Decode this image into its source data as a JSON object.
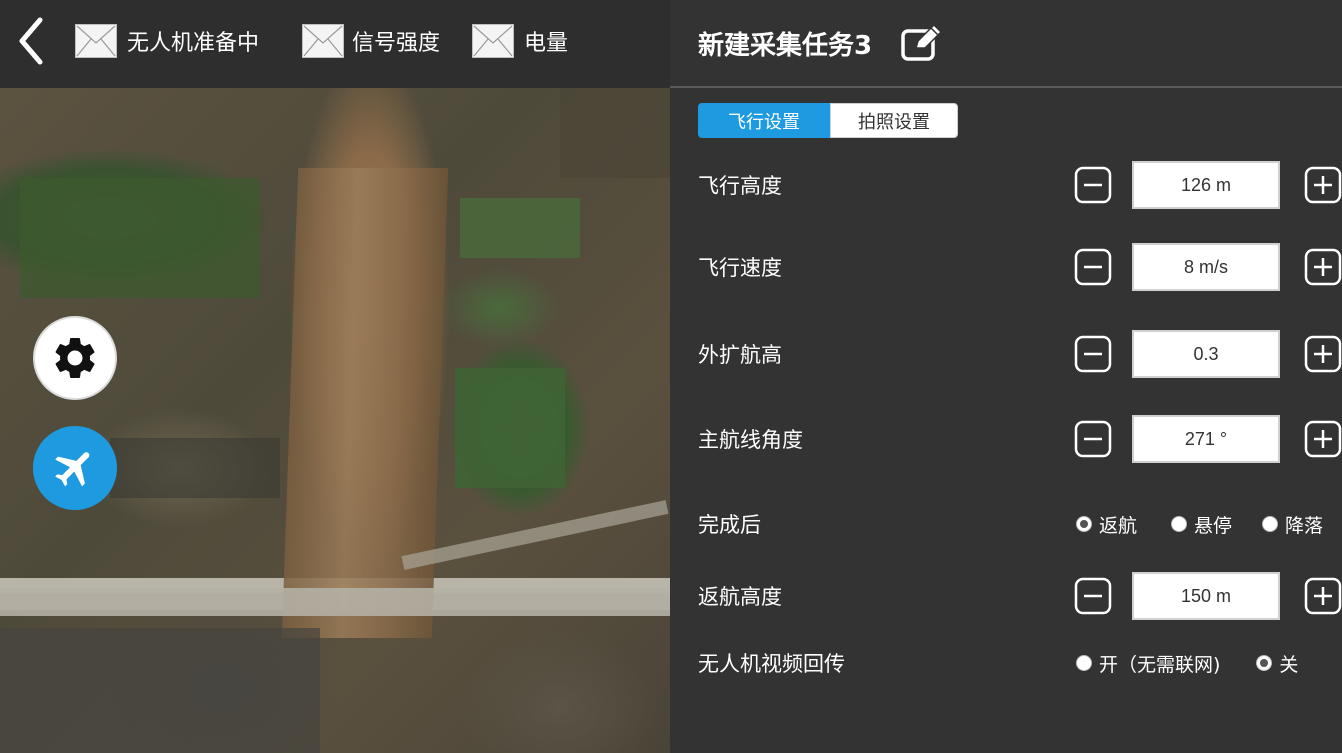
{
  "status_bar": {
    "items": [
      {
        "label": "无人机准备中",
        "icon": "image-placeholder-icon"
      },
      {
        "label": "信号强度",
        "icon": "image-placeholder-icon"
      },
      {
        "label": "电量",
        "icon": "image-placeholder-icon"
      }
    ]
  },
  "panel": {
    "title": "新建采集任务3",
    "tabs": [
      {
        "label": "飞行设置",
        "active": true
      },
      {
        "label": "拍照设置",
        "active": false
      }
    ],
    "fields": {
      "flight_altitude": {
        "label": "飞行高度",
        "value": "126 m"
      },
      "flight_speed": {
        "label": "飞行速度",
        "value": "8 m/s"
      },
      "extend_altitude": {
        "label": "外扩航高",
        "value": "0.3"
      },
      "main_route_angle": {
        "label": "主航线角度",
        "value": "271 °"
      },
      "return_altitude": {
        "label": "返航高度",
        "value": "150 m"
      }
    },
    "after_completion": {
      "label": "完成后",
      "options": [
        "返航",
        "悬停",
        "降落"
      ],
      "selected": "返航"
    },
    "video_return": {
      "label": "无人机视频回传",
      "options": [
        "开（无需联网)",
        "关"
      ],
      "selected": "关"
    }
  },
  "colors": {
    "accent": "#1e9be0",
    "panel_bg": "#333333",
    "topbar_bg": "#2e2e2e"
  }
}
